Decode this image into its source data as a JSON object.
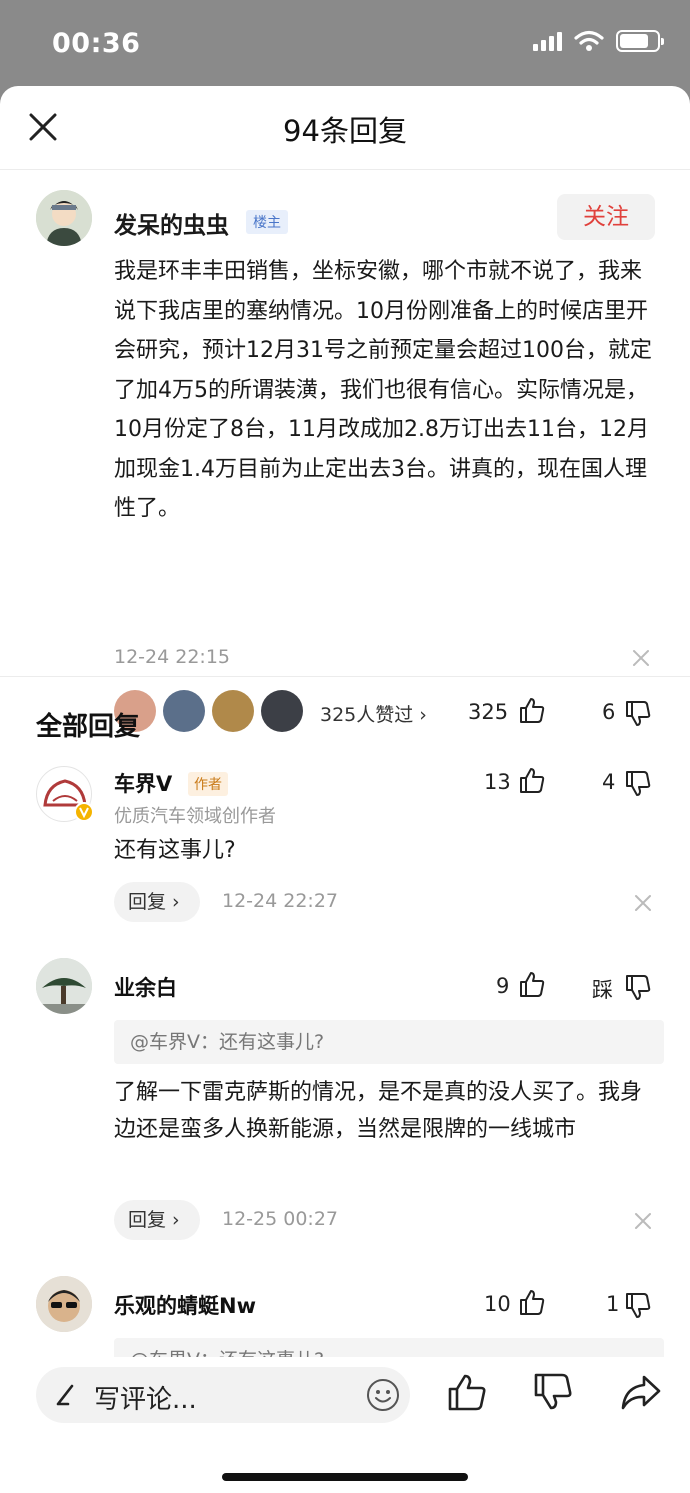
{
  "status": {
    "time": "00:36"
  },
  "header": {
    "title": "94条回复"
  },
  "post": {
    "author": "发呆的虫虫",
    "badge": "楼主",
    "follow_label": "关注",
    "body": "我是环丰丰田销售，坐标安徽，哪个市就不说了，我来说下我店里的塞纳情况。10月份刚准备上的时候店里开会研究，预计12月31号之前预定量会超过100台，就定了加4万5的所谓装潢，我们也很有信心。实际情况是，10月份定了8台，11月改成加2.8万订出去11台，12月加现金1.4万目前为止定出去3台。讲真的，现在国人理性了。",
    "time": "12-24 22:15",
    "liked_by": "325人赞过 ›",
    "likes": "325",
    "dislikes": "6"
  },
  "section": {
    "title": "全部回复"
  },
  "replies": [
    {
      "name": "车界V",
      "tag": "作者",
      "subtitle": "优质汽车领域创作者",
      "likes": "13",
      "dislikes": "4",
      "body": "还有这事儿?",
      "reply_label": "回复 ›",
      "time": "12-24 22:27"
    },
    {
      "name": "业余白",
      "likes": "9",
      "dislikes": "踩",
      "quote": "@车界V：还有这事儿?",
      "body": "了解一下雷克萨斯的情况，是不是真的没人买了。我身边还是蛮多人换新能源，当然是限牌的一线城市",
      "reply_label": "回复 ›",
      "time": "12-25 00:27"
    },
    {
      "name": "乐观的蜻蜓Nw",
      "likes": "10",
      "dislikes": "1",
      "quote": "@车界V：还有这事儿?"
    }
  ],
  "bottom": {
    "comment_placeholder": "写评论..."
  },
  "colors": {
    "accent_red": "#e0413c",
    "badge_blue": "#4a76c9",
    "author_orange": "#c97b19"
  }
}
